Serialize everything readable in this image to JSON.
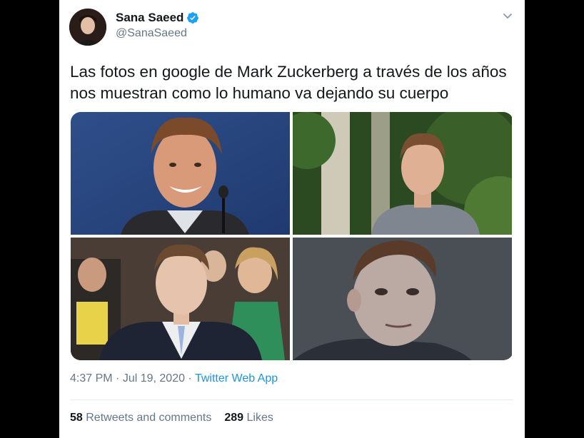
{
  "author": {
    "name": "Sana Saeed",
    "handle": "@SanaSaeed"
  },
  "tweet": {
    "text_line1": "Las fotos en google de Mark Zuckerberg a través de los años",
    "text_line2": "nos muestran como lo humano va dejando su cuerpo"
  },
  "meta": {
    "time": "4:37 PM",
    "separator1": " · ",
    "date": "Jul 19, 2020",
    "separator2": " · ",
    "source": "Twitter Web App"
  },
  "stats": {
    "retweets_count": "58",
    "retweets_label": "Retweets and comments",
    "likes_count": "289",
    "likes_label": "Likes"
  },
  "icons": {
    "verified": "verified-badge-icon",
    "more": "chevron-down-icon"
  },
  "colors": {
    "accent": "#1DA1F2",
    "link": "#1B95E0",
    "secondary_text": "#657786",
    "primary_text": "#14171A"
  }
}
